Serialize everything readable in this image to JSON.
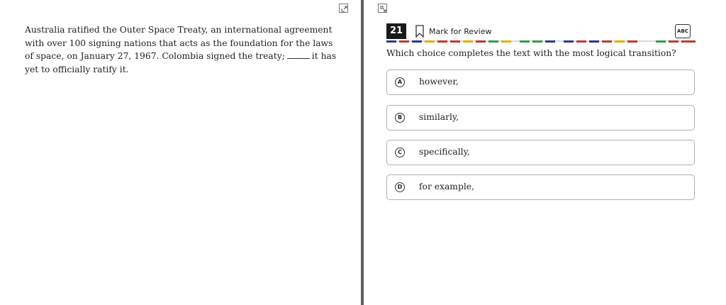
{
  "passage": {
    "before_blank": "Australia ratified the Outer Space Treaty, an international agreement with over 100 signing nations that acts as the foundation for the laws of space, on January 27, 1967. Colombia signed the treaty;",
    "after_blank": "it has yet to officially ratify it."
  },
  "question": {
    "number": "21",
    "mark_for_review": "Mark for Review",
    "abc_label": "ABC",
    "prompt": "Which choice completes the text with the most logical transition?",
    "choices": [
      {
        "letter": "A",
        "text": "however,"
      },
      {
        "letter": "B",
        "text": "similarly,"
      },
      {
        "letter": "C",
        "text": "specifically,"
      },
      {
        "letter": "D",
        "text": "for example,"
      }
    ]
  },
  "colors": {
    "divider": "#5f5f5f",
    "dash_blue": "#2b3a8c",
    "dash_red": "#c0392b",
    "dash_yellow": "#e0b000",
    "dash_green": "#2e9e4e"
  }
}
